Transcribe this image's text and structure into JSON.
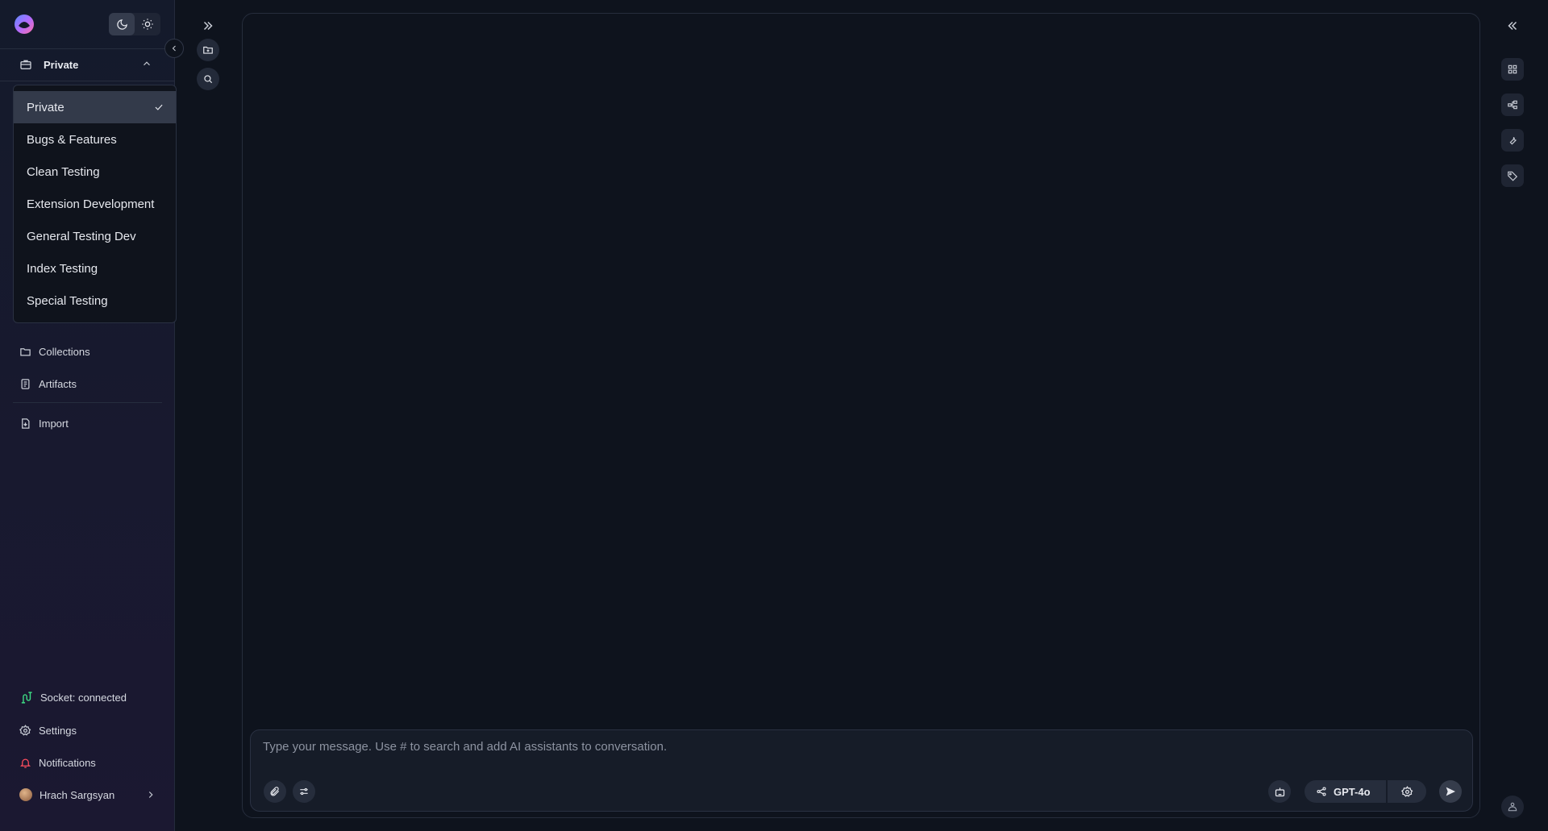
{
  "app": {
    "accent": "#7b61ff",
    "status_color": "#3ddc84",
    "notification_color": "#ff4d5e"
  },
  "sidebar": {
    "workspace": {
      "label": "Private"
    },
    "dropdown": {
      "items": [
        {
          "label": "Private",
          "selected": true
        },
        {
          "label": "Bugs & Features"
        },
        {
          "label": "Clean Testing"
        },
        {
          "label": "Extension Development"
        },
        {
          "label": "General Testing Dev"
        },
        {
          "label": "Index Testing"
        },
        {
          "label": "Special Testing"
        }
      ]
    },
    "nav": [
      {
        "label": "Collections",
        "icon": "folder-icon"
      },
      {
        "label": "Artifacts",
        "icon": "artifact-icon"
      },
      {
        "label": "Import",
        "icon": "import-file-icon"
      }
    ],
    "footer": {
      "socket_status": "Socket: connected",
      "settings": "Settings",
      "notifications": "Notifications",
      "user_name": "Hrach Sargsyan"
    }
  },
  "composer": {
    "placeholder": "Type your message. Use # to search and add AI assistants to conversation.",
    "model": "GPT-4o"
  },
  "icons": {
    "theme_dark": "moon-icon",
    "theme_light": "sun-icon",
    "left_rail": [
      "expand-icon",
      "new-folder-icon",
      "search-icon"
    ],
    "right_rail": [
      "collapse-icon",
      "grid-icon",
      "workflow-icon",
      "wrench-icon",
      "tag-icon",
      "assistant-icon"
    ]
  }
}
